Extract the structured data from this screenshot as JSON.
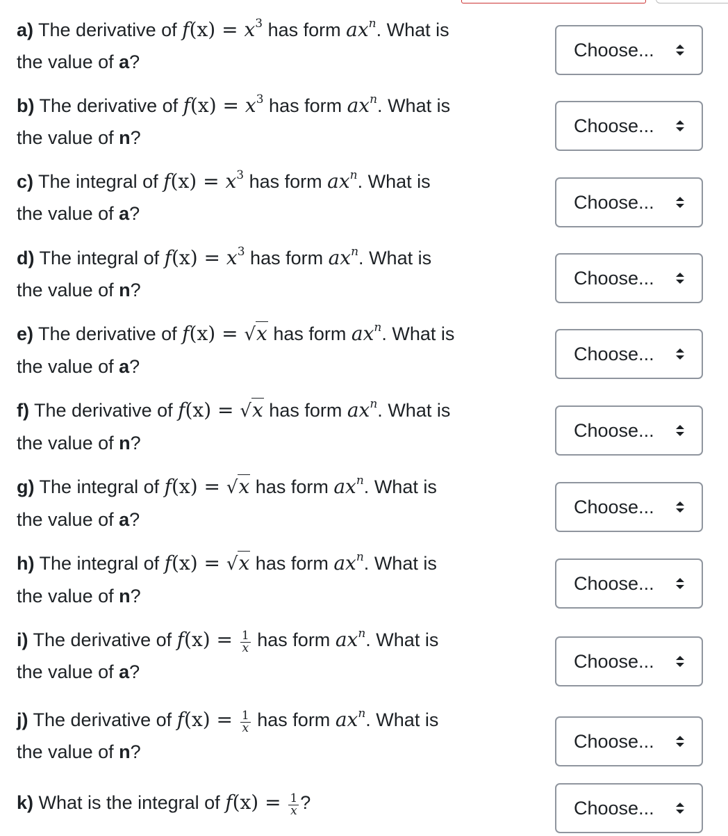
{
  "common": {
    "has_form": "has form",
    "what_is": "What is",
    "the_value_of": "the value of",
    "f_of_x": "f",
    "expr_paren": "(x) =",
    "x": "x",
    "cube": "3",
    "one": "1",
    "sqrt_sign": "√",
    "ax_base": "ax",
    "ax_exp": "n",
    "period": ".",
    "question_mark": "?",
    "var_a": "a",
    "var_n": "n"
  },
  "questions": [
    {
      "label": "a)",
      "lead": "The derivative of",
      "var": "a",
      "select": "Choose..."
    },
    {
      "label": "b)",
      "lead": "The derivative of",
      "var": "n",
      "select": "Choose..."
    },
    {
      "label": "c)",
      "lead": "The integral of",
      "var": "a",
      "select": "Choose..."
    },
    {
      "label": "d)",
      "lead": "The integral of",
      "var": "n",
      "select": "Choose..."
    },
    {
      "label": "e)",
      "lead": "The derivative of",
      "var": "a",
      "select": "Choose..."
    },
    {
      "label": "f)",
      "lead": "The derivative of",
      "var": "n",
      "select": "Choose..."
    },
    {
      "label": "g)",
      "lead": "The integral of",
      "var": "a",
      "select": "Choose..."
    },
    {
      "label": "h)",
      "lead": "The integral of",
      "var": "n",
      "select": "Choose..."
    },
    {
      "label": "i)",
      "lead": "The derivative of",
      "var": "a",
      "select": "Choose..."
    },
    {
      "label": "j)",
      "lead": "The derivative of",
      "var": "n",
      "select": "Choose..."
    },
    {
      "label": "k)",
      "lead": "What is the integral of",
      "select": "Choose..."
    }
  ],
  "icons": {
    "select_arrows": "up-down-chevron-icon"
  },
  "colors": {
    "text": "#1d2125",
    "select_border": "#8f959e",
    "highlight_border": "#cc3333"
  }
}
